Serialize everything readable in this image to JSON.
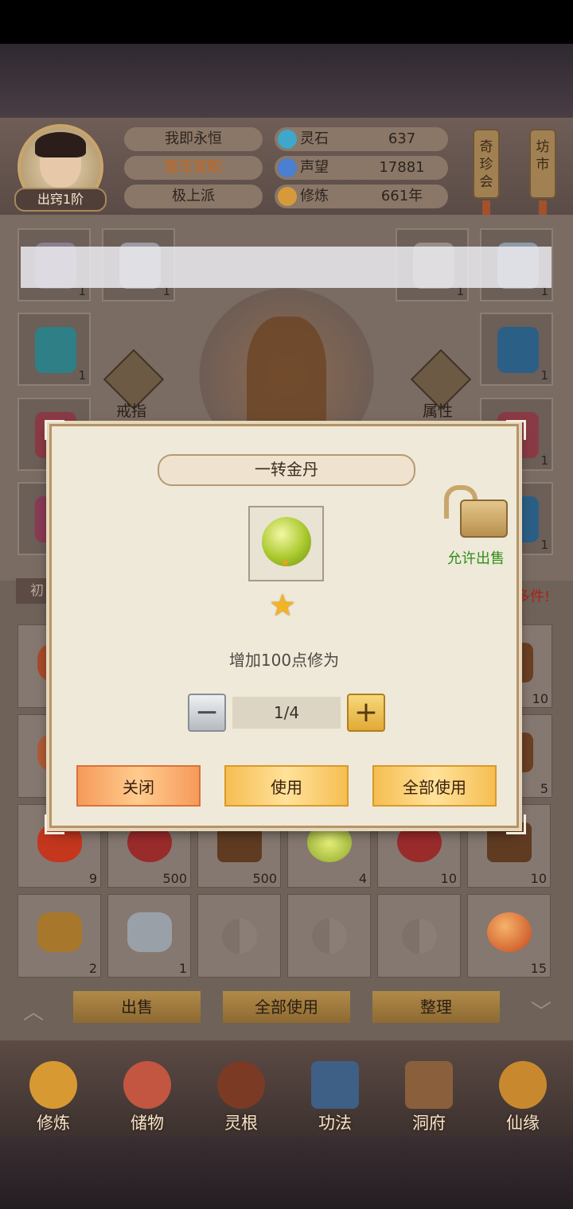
{
  "header": {
    "rank": "出窍1阶",
    "name": "我即永恒",
    "official": "暂无官职",
    "sect": "极上派",
    "stats": [
      {
        "label": "灵石",
        "value": "637",
        "icon": "spirit-stone-icon",
        "color": "#3fa7c9"
      },
      {
        "label": "声望",
        "value": "17881",
        "icon": "prestige-icon",
        "color": "#4a7fd1"
      },
      {
        "label": "修炼",
        "value": "661年",
        "icon": "meditation-icon",
        "color": "#d69a3b"
      }
    ],
    "banners": [
      "奇珍会",
      "坊市"
    ]
  },
  "equipment": {
    "ring_label": "戒指",
    "attr_label": "属性",
    "slot_counts": [
      "1",
      "1",
      "1",
      "1",
      "1",
      "1",
      "1",
      "1",
      "1",
      "1",
      "1",
      "1"
    ]
  },
  "inventory": {
    "tab_label": "初",
    "notice": "多件!",
    "rows": [
      [
        "",
        "",
        "",
        "",
        "",
        "10"
      ],
      [
        "",
        "",
        "",
        "",
        "",
        "5"
      ],
      [
        "9",
        "500",
        "500",
        "4",
        "10",
        "10"
      ],
      [
        "2",
        "1",
        "",
        "",
        "",
        "15"
      ]
    ],
    "actions": [
      "出售",
      "全部使用",
      "整理"
    ]
  },
  "bottom_nav": [
    "修炼",
    "储物",
    "灵根",
    "功法",
    "洞府",
    "仙缘"
  ],
  "dialog": {
    "title": "一转金丹",
    "stars": "★",
    "description": "增加100点修为",
    "quantity": "1/4",
    "lock_label": "允许出售",
    "buttons": {
      "close": "关闭",
      "use": "使用",
      "use_all": "全部使用"
    },
    "minus": "−",
    "plus": "+"
  }
}
